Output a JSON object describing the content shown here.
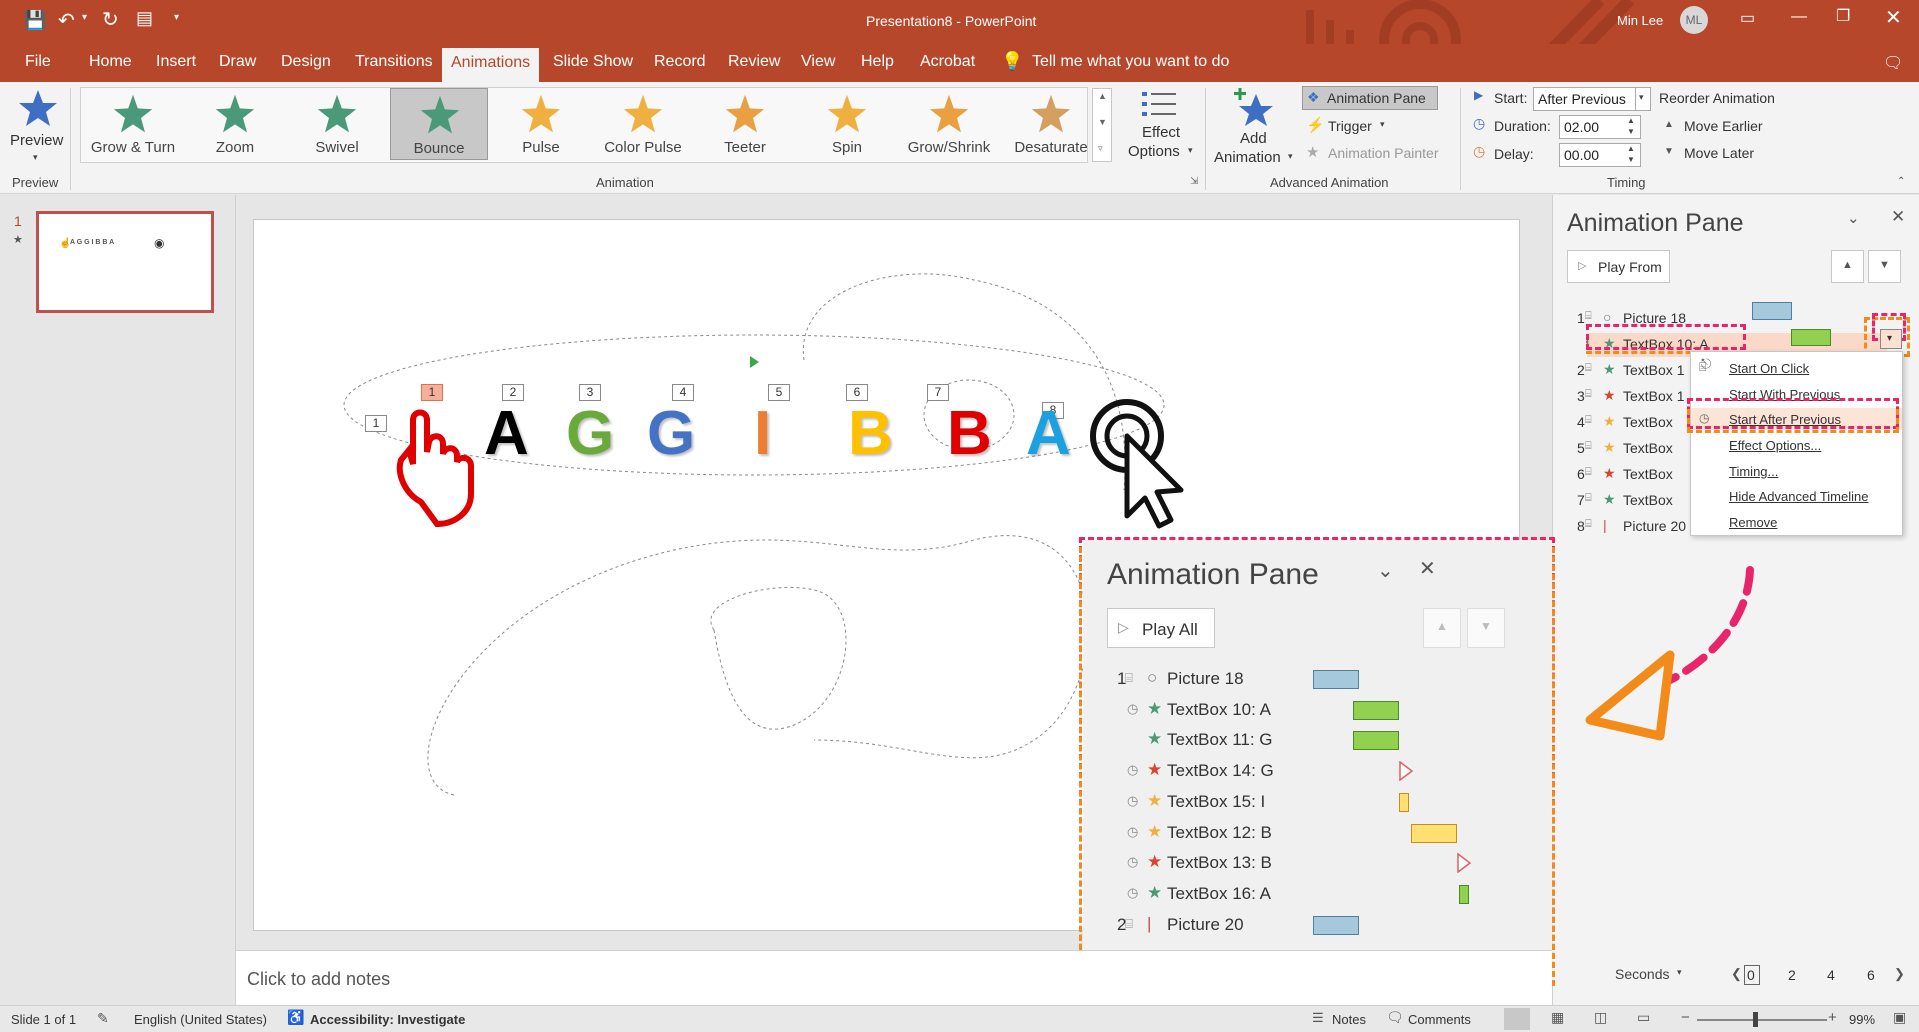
{
  "window": {
    "title": "Presentation8  -  PowerPoint",
    "user_name": "Min Lee",
    "user_initials": "ML"
  },
  "tabs": [
    "File",
    "Home",
    "Insert",
    "Draw",
    "Design",
    "Transitions",
    "Animations",
    "Slide Show",
    "Record",
    "Review",
    "View",
    "Help",
    "Acrobat"
  ],
  "active_tab": "Animations",
  "tell_me": "Tell me what you want to do",
  "ribbon": {
    "preview_label": "Preview",
    "preview_group": "Preview",
    "animations": [
      "Grow & Turn",
      "Zoom",
      "Swivel",
      "Bounce",
      "Pulse",
      "Color Pulse",
      "Teeter",
      "Spin",
      "Grow/Shrink",
      "Desaturate"
    ],
    "selected_animation": "Bounce",
    "effect_options_line1": "Effect",
    "effect_options_line2": "Options",
    "animation_group": "Animation",
    "add_animation_line1": "Add",
    "add_animation_line2": "Animation",
    "animation_pane_btn": "Animation Pane",
    "trigger_btn": "Trigger",
    "animation_painter_btn": "Animation Painter",
    "advanced_group": "Advanced Animation",
    "start_label": "Start:",
    "start_value": "After Previous",
    "duration_label": "Duration:",
    "duration_value": "02.00",
    "delay_label": "Delay:",
    "delay_value": "00.00",
    "reorder_label": "Reorder Animation",
    "move_earlier": "Move Earlier",
    "move_later": "Move Later",
    "timing_group": "Timing"
  },
  "thumb": {
    "slide_number": "1",
    "mini_letters": "A G G I B B A"
  },
  "slide": {
    "letters": [
      "A",
      "G",
      "G",
      "I",
      "B",
      "B",
      "A"
    ],
    "letter_colors": [
      "#000000",
      "#6aaa3a",
      "#4472c4",
      "#ed7d31",
      "#ffc000",
      "#e00000",
      "#1ba1e2"
    ],
    "number_tags": [
      "1",
      "1",
      "2",
      "3",
      "4",
      "5",
      "6",
      "7",
      "8"
    ]
  },
  "anim_pane": {
    "title": "Animation Pane",
    "play_from": "Play From",
    "rows": [
      {
        "num": "1",
        "name": "Picture 18"
      },
      {
        "num": "",
        "name": "TextBox 10: A"
      },
      {
        "num": "2",
        "name": "TextBox 1"
      },
      {
        "num": "3",
        "name": "TextBox 1"
      },
      {
        "num": "4",
        "name": "TextBox"
      },
      {
        "num": "5",
        "name": "TextBox"
      },
      {
        "num": "6",
        "name": "TextBox"
      },
      {
        "num": "7",
        "name": "TextBox"
      },
      {
        "num": "8",
        "name": "Picture 20"
      }
    ],
    "seconds_label": "Seconds",
    "scale": [
      "0",
      "2",
      "4",
      "6"
    ]
  },
  "context_menu": [
    "Start On Click",
    "Start With Previous",
    "Start After Previous",
    "Effect Options...",
    "Timing...",
    "Hide Advanced Timeline",
    "Remove"
  ],
  "zoom_panel": {
    "title": "Animation Pane",
    "play_all": "Play All",
    "rows": [
      {
        "num": "1",
        "name": "Picture 18"
      },
      {
        "num": "",
        "name": "TextBox 10: A"
      },
      {
        "num": "",
        "name": "TextBox 11: G"
      },
      {
        "num": "",
        "name": "TextBox 14: G"
      },
      {
        "num": "",
        "name": "TextBox 15: I"
      },
      {
        "num": "",
        "name": "TextBox 12: B"
      },
      {
        "num": "",
        "name": "TextBox 13: B"
      },
      {
        "num": "",
        "name": "TextBox 16: A"
      },
      {
        "num": "2",
        "name": "Picture 20"
      }
    ]
  },
  "notes_placeholder": "Click to add notes",
  "status": {
    "slide_info": "Slide 1 of 1",
    "language": "English (United States)",
    "accessibility": "Accessibility: Investigate",
    "notes": "Notes",
    "comments": "Comments",
    "zoom": "99%"
  },
  "colors": {
    "accent": "#b7472a",
    "highlight_pink": "#e8246b",
    "highlight_orange": "#f28b1a"
  }
}
